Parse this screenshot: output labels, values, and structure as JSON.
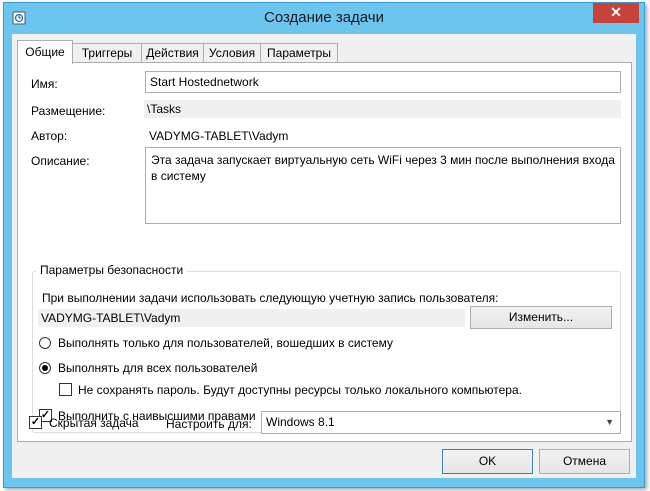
{
  "window": {
    "title": "Создание задачи",
    "close_glyph": "✕"
  },
  "tabs": [
    {
      "label": "Общие"
    },
    {
      "label": "Триггеры"
    },
    {
      "label": "Действия"
    },
    {
      "label": "Условия"
    },
    {
      "label": "Параметры"
    }
  ],
  "general": {
    "name_label": "Имя:",
    "name_value": "Start Hostednetwork",
    "location_label": "Размещение:",
    "location_value": "\\Tasks",
    "author_label": "Автор:",
    "author_value": "VADYMG-TABLET\\Vadym",
    "description_label": "Описание:",
    "description_value": "Эта задача запускает виртуальную сеть WiFi через 3 мин после выполнения входа в систему"
  },
  "security": {
    "group_title": "Параметры безопасности",
    "run_as_text": "При выполнении задачи использовать следующую учетную запись пользователя:",
    "account": "VADYMG-TABLET\\Vadym",
    "change_button": "Изменить...",
    "radio_logged_on": "Выполнять только для пользователей, вошедших в систему",
    "radio_all_users": "Выполнять для всех пользователей",
    "no_store_password": "Не сохранять пароль. Будут доступны ресурсы только локального компьютера.",
    "highest_privileges": "Выполнить с наивысшими правами",
    "selected_radio": "all_users",
    "no_store_password_checked": false,
    "highest_privileges_checked": true
  },
  "footer": {
    "hidden_label": "Скрытая задача",
    "hidden_checked": true,
    "configure_label": "Настроить для:",
    "configure_value": "Windows 8.1",
    "ok_button": "OK",
    "cancel_button": "Отмена"
  },
  "colors": {
    "title_bar": "#6cc5ee",
    "close_button": "#c7433a",
    "panel": "#f0f0f0"
  }
}
